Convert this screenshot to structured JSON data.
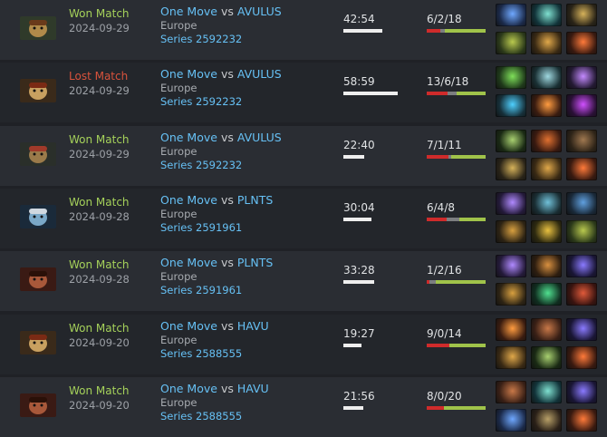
{
  "matches": [
    {
      "hero_icon": "bounty-hunter-portrait",
      "result": "Won Match",
      "outcome": "win",
      "date": "2024-09-29",
      "team": "One Move",
      "vs": "vs",
      "opponent": "AVULUS",
      "region": "Europe",
      "series": "Series 2592232",
      "duration": "42:54",
      "duration_fraction": 0.72,
      "kda": "6/2/18",
      "kills": 6,
      "deaths": 2,
      "assists": 18,
      "items": [
        "blink-dagger-icon",
        "ethereal-blade-icon",
        "black-king-bar-icon",
        "pipe-icon",
        "force-staff-icon",
        "phase-boots-icon"
      ]
    },
    {
      "hero_icon": "kunkka-portrait",
      "result": "Lost Match",
      "outcome": "loss",
      "date": "2024-09-29",
      "team": "One Move",
      "vs": "vs",
      "opponent": "AVULUS",
      "region": "Europe",
      "series": "Series 2592232",
      "duration": "58:59",
      "duration_fraction": 1.0,
      "kda": "13/6/18",
      "kills": 13,
      "deaths": 6,
      "assists": 18,
      "items": [
        "aghanims-scepter-icon",
        "glimmer-cape-icon",
        "nullifier-icon",
        "battlefury-icon",
        "radiance-icon",
        "khanda-icon"
      ]
    },
    {
      "hero_icon": "troll-warlord-portrait",
      "result": "Won Match",
      "outcome": "win",
      "date": "2024-09-29",
      "team": "One Move",
      "vs": "vs",
      "opponent": "AVULUS",
      "region": "Europe",
      "series": "Series 2592232",
      "duration": "22:40",
      "duration_fraction": 0.38,
      "kda": "7/1/11",
      "kills": 7,
      "deaths": 1,
      "assists": 11,
      "items": [
        "mjollnir-icon",
        "desolator-icon",
        "boots-of-speed-icon",
        "black-king-bar-icon",
        "force-staff-icon",
        "phase-boots-icon"
      ]
    },
    {
      "hero_icon": "zeus-portrait",
      "result": "Won Match",
      "outcome": "win",
      "date": "2024-09-28",
      "team": "One Move",
      "vs": "vs",
      "opponent": "PLNTS",
      "region": "Europe",
      "series": "Series 2591961",
      "duration": "30:04",
      "duration_fraction": 0.51,
      "kda": "6/4/8",
      "kills": 6,
      "deaths": 4,
      "assists": 8,
      "items": [
        "aether-lens-icon",
        "kaya-icon",
        "arcane-boots-icon",
        "vladmirs-offering-icon",
        "hand-of-midas-icon",
        "pipe-icon"
      ]
    },
    {
      "hero_icon": "huskar-portrait",
      "result": "Won Match",
      "outcome": "win",
      "date": "2024-09-28",
      "team": "One Move",
      "vs": "vs",
      "opponent": "PLNTS",
      "region": "Europe",
      "series": "Series 2591961",
      "duration": "33:28",
      "duration_fraction": 0.56,
      "kda": "1/2/16",
      "kills": 1,
      "deaths": 2,
      "assists": 16,
      "items": [
        "aether-lens-icon",
        "guardian-greaves-icon",
        "boots-of-travel-icon",
        "vladmirs-offering-icon",
        "eternal-shroud-icon",
        "heart-of-tarrasque-icon"
      ]
    },
    {
      "hero_icon": "kunkka-portrait",
      "result": "Won Match",
      "outcome": "win",
      "date": "2024-09-20",
      "team": "One Move",
      "vs": "vs",
      "opponent": "HAVU",
      "region": "Europe",
      "series": "Series 2588555",
      "duration": "19:27",
      "duration_fraction": 0.33,
      "kda": "9/0/14",
      "kills": 9,
      "deaths": 0,
      "assists": 14,
      "items": [
        "radiance-icon",
        "armlet-icon",
        "boots-of-travel-icon",
        "force-staff-icon",
        "mjollnir-icon",
        "phase-boots-icon"
      ]
    },
    {
      "hero_icon": "huskar-portrait",
      "result": "Won Match",
      "outcome": "win",
      "date": "2024-09-20",
      "team": "One Move",
      "vs": "vs",
      "opponent": "HAVU",
      "region": "Europe",
      "series": "Series 2588555",
      "duration": "21:56",
      "duration_fraction": 0.37,
      "kda": "8/0/20",
      "kills": 8,
      "deaths": 0,
      "assists": 20,
      "items": [
        "armlet-icon",
        "ethereal-blade-icon",
        "boots-of-travel-icon",
        "blink-dagger-icon",
        "vanguard-icon",
        "phase-boots-icon"
      ]
    }
  ],
  "colors": {
    "win": "#a5d15a",
    "loss": "#d9533c",
    "link": "#66c0f4",
    "kills": "#cf2b2b",
    "deaths": "#7c7e80",
    "assists": "#a0c34a"
  }
}
